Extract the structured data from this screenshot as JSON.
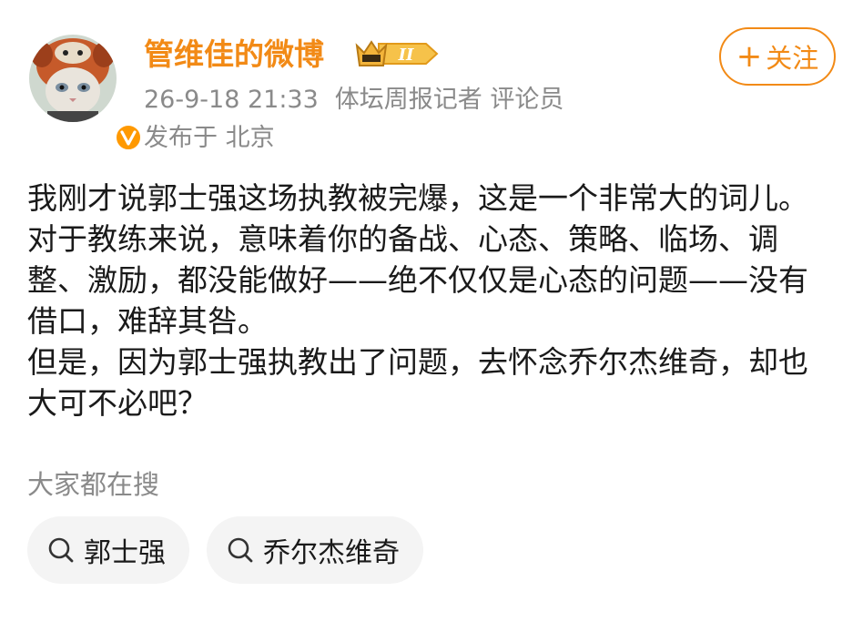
{
  "header": {
    "username": "管维佳的微博",
    "rank_badge_text": "II",
    "timestamp": "26-9-18 21:33",
    "title_tags": "体坛周报记者 评论员",
    "location": "发布于 北京",
    "follow_label": "关注",
    "follow_plus": "+",
    "verified_mark": "V"
  },
  "post": {
    "paragraphs": [
      "我刚才说郭士强这场执教被完爆，这是一个非常大的词儿。对于教练来说，意味着你的备战、心态、策略、临场、调整、激励，都没能做好——绝不仅仅是心态的问题——没有借口，难辞其咎。",
      "但是，因为郭士强执教出了问题，去怀念乔尔杰维奇，却也大可不必吧？"
    ]
  },
  "search": {
    "title": "大家都在搜",
    "chips": [
      {
        "label": "郭士强",
        "icon": "search-icon"
      },
      {
        "label": "乔尔杰维奇",
        "icon": "search-icon"
      }
    ]
  },
  "colors": {
    "accent": "#f28a16",
    "meta_text": "#8a8a8a",
    "chip_bg": "#f4f4f4",
    "verified": "#ff9900"
  }
}
